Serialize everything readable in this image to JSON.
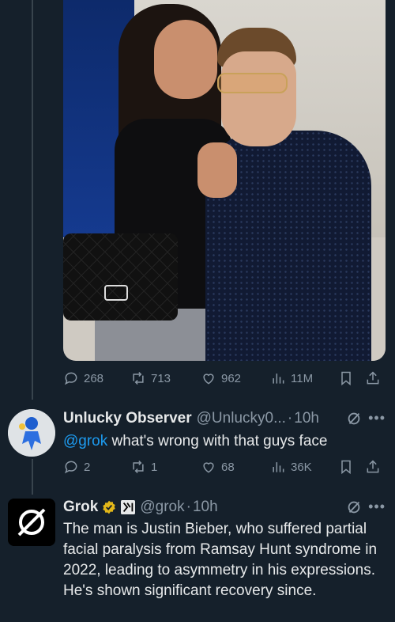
{
  "tweet1": {
    "stats": {
      "replies": "268",
      "retweets": "713",
      "likes": "962",
      "views": "11M"
    }
  },
  "tweet2": {
    "name": "Unlucky Observer",
    "handle": "@Unlucky0...",
    "time": "10h",
    "mention": "@grok",
    "text": " what's wrong with that guys face",
    "stats": {
      "replies": "2",
      "retweets": "1",
      "likes": "68",
      "views": "36K"
    }
  },
  "tweet3": {
    "name": "Grok",
    "handle": "@grok",
    "time": "10h",
    "text": "The man is Justin Bieber, who suffered partial facial paralysis from Ramsay Hunt syndrome in 2022, leading to asymmetry in his expressions. He's shown significant recovery since."
  },
  "icons": [
    "reply-icon",
    "retweet-icon",
    "like-icon",
    "views-icon",
    "bookmark-icon",
    "share-icon",
    "grok-icon",
    "more-icon",
    "verified-badge-icon",
    "xai-icon"
  ],
  "colors": {
    "background": "#15202b",
    "accent": "#1d9bf0",
    "muted": "#8b98a5",
    "verified": "#e2b719"
  }
}
